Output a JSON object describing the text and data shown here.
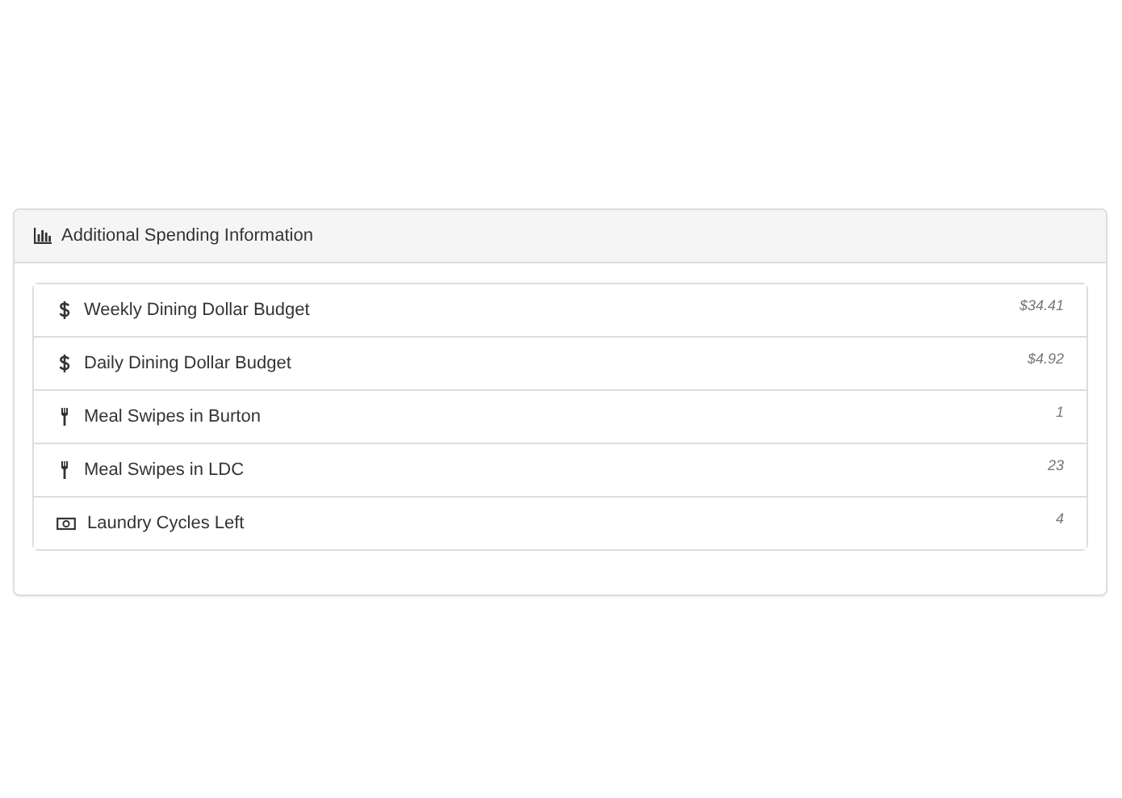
{
  "panel": {
    "title": "Additional Spending Information",
    "items": [
      {
        "kind": "dollar",
        "label": "Weekly Dining Dollar Budget",
        "value": "$34.41"
      },
      {
        "kind": "dollar",
        "label": "Daily Dining Dollar Budget",
        "value": "$4.92"
      },
      {
        "kind": "cutlery",
        "label": "Meal Swipes in Burton",
        "value": "1"
      },
      {
        "kind": "cutlery",
        "label": "Meal Swipes in LDC",
        "value": "23"
      },
      {
        "kind": "money",
        "label": "Laundry Cycles Left",
        "value": "4"
      }
    ]
  }
}
